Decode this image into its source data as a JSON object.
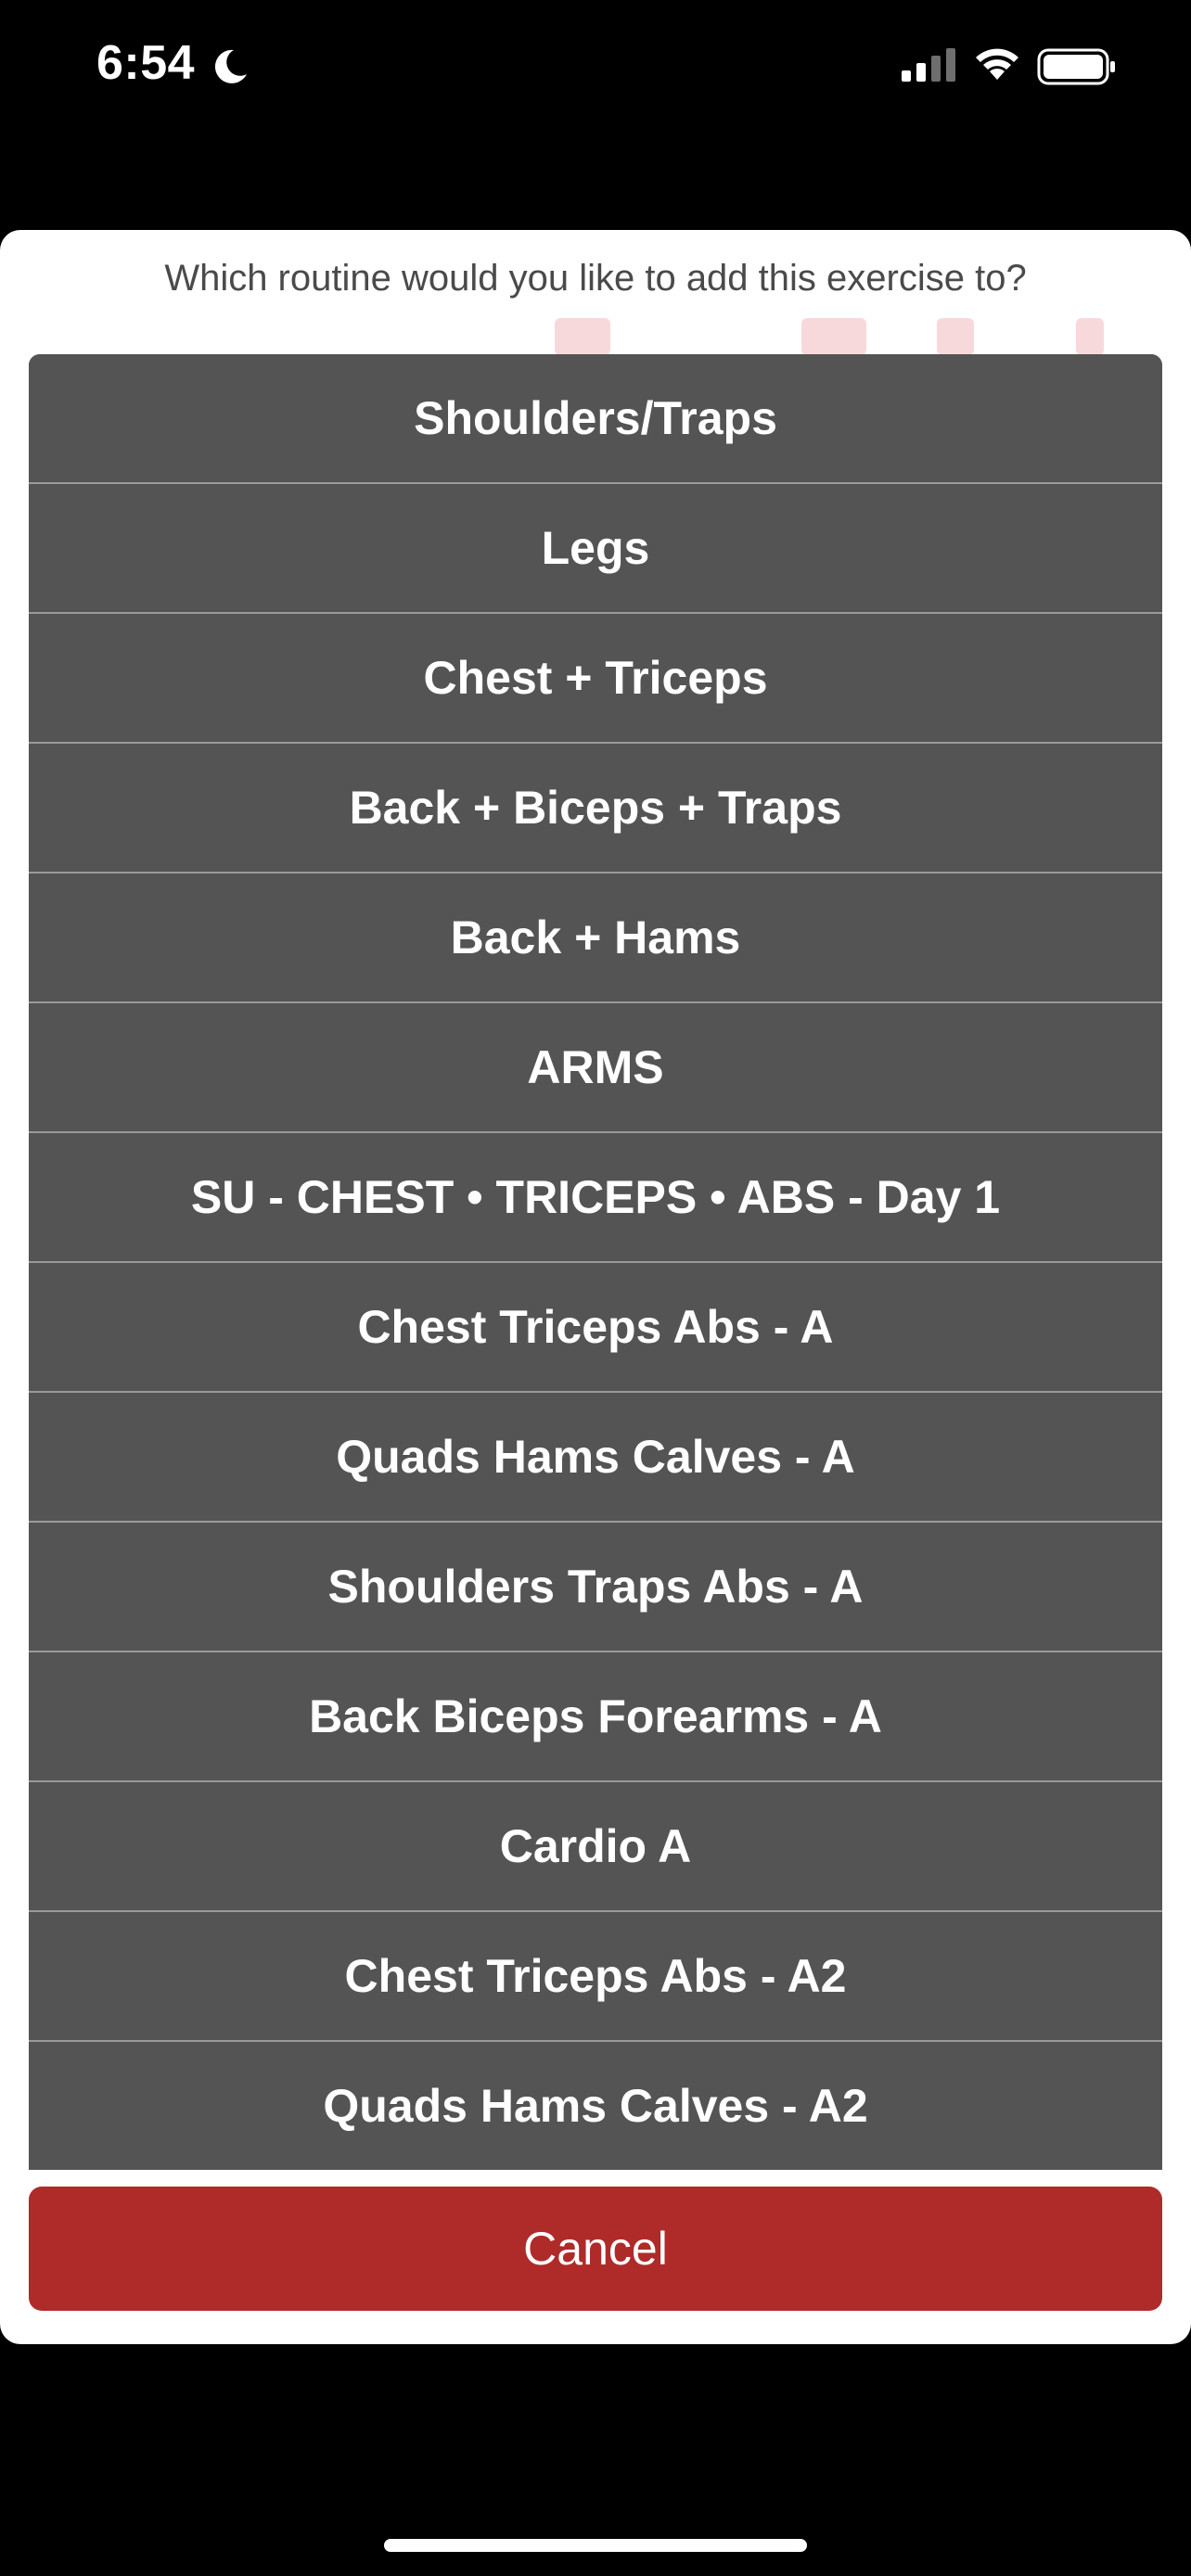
{
  "status_bar": {
    "time": "6:54",
    "icons": [
      "moon-icon",
      "signal-icon",
      "wifi-icon",
      "battery-icon"
    ]
  },
  "sheet": {
    "title": "Which routine would you like to add this exercise to?",
    "routines": [
      "Shoulders/Traps",
      "Legs",
      "Chest + Triceps",
      "Back + Biceps + Traps",
      "Back + Hams",
      "ARMS",
      "SU - CHEST • TRICEPS • ABS - Day 1",
      "Chest Triceps Abs - A",
      "Quads Hams Calves - A",
      "Shoulders Traps Abs - A",
      "Back Biceps Forearms - A",
      "Cardio A",
      "Chest Triceps Abs - A2",
      "Quads Hams Calves - A2"
    ],
    "cancel_label": "Cancel"
  },
  "colors": {
    "list_item_bg": "#545454",
    "list_divider": "#9a9a9a",
    "cancel_bg": "#ae2b2a",
    "sheet_bg": "#ffffff",
    "screen_bg": "#000000"
  }
}
